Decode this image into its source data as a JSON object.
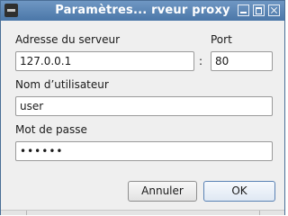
{
  "window": {
    "title": "Paramètres... rveur proxy",
    "icons": {
      "app": "terminal-icon",
      "minimize": "minimize-icon",
      "maximize": "maximize-icon",
      "close": "close-icon"
    }
  },
  "form": {
    "server_label": "Adresse du serveur",
    "server_value": "127.0.0.1",
    "separator": ":",
    "port_label": "Port",
    "port_value": "80",
    "username_label": "Nom d’utilisateur",
    "username_value": "user",
    "password_label": "Mot de passe",
    "password_value": "••••••"
  },
  "buttons": {
    "cancel": "Annuler",
    "ok": "OK"
  },
  "colors": {
    "titlebar": "#4b77a8",
    "window_bg": "#efefef",
    "default_button_border": "#5a82b4"
  }
}
